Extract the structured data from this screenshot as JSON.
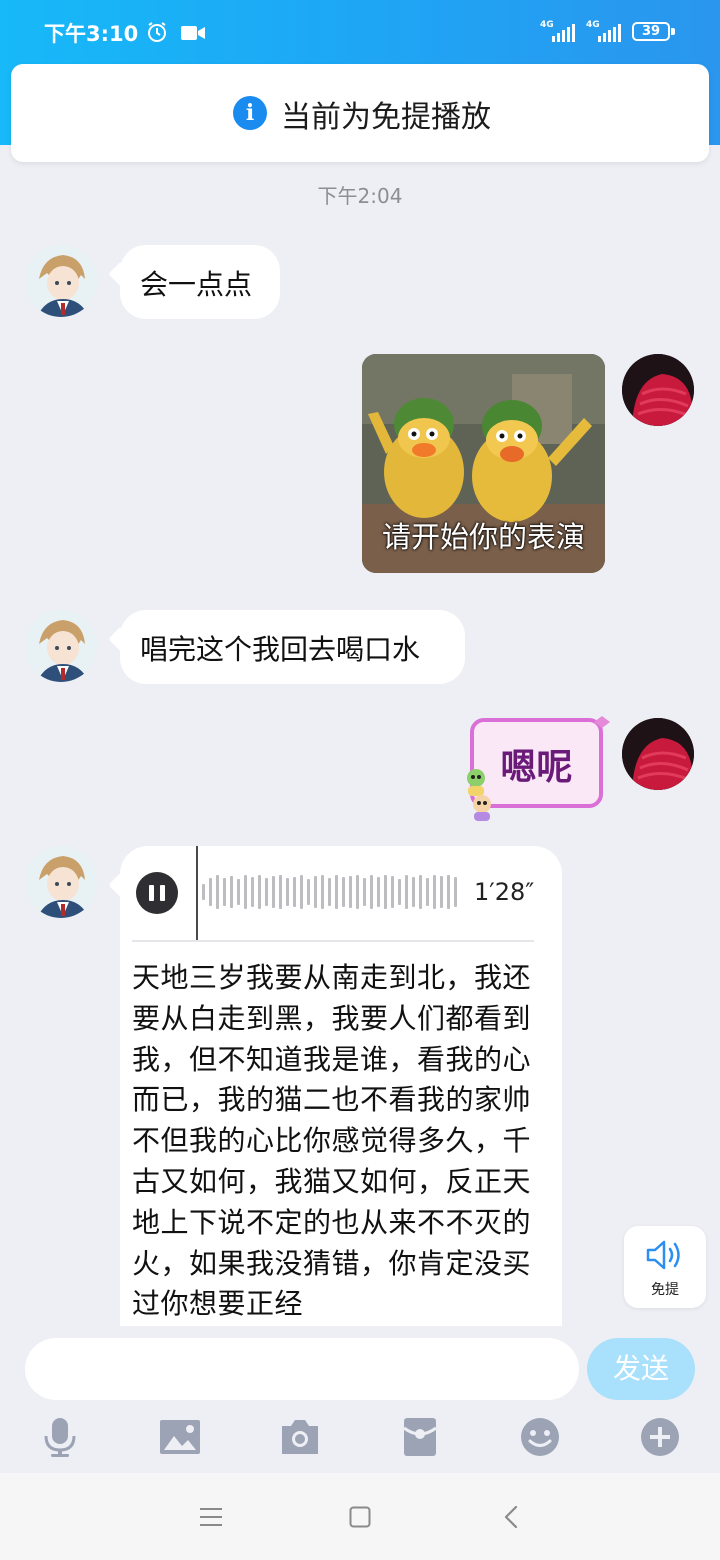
{
  "status_bar": {
    "time": "下午3:10",
    "network_1": "4G",
    "network_2": "4G",
    "battery": "39"
  },
  "notice": {
    "icon": "info-icon",
    "text": "当前为免提播放"
  },
  "chat": {
    "timestamp": "下午2:04",
    "messages": [
      {
        "from": "friend",
        "type": "text",
        "text": "会一点点"
      },
      {
        "from": "me",
        "type": "sticker",
        "caption": "请开始你的表演"
      },
      {
        "from": "friend",
        "type": "text",
        "text": "唱完这个我回去喝口水"
      },
      {
        "from": "me",
        "type": "sticker",
        "caption": "嗯呢"
      },
      {
        "from": "friend",
        "type": "voice",
        "duration": "1′28″",
        "transcript": "天地三岁我要从南走到北，我还要从白走到黑，我要人们都看到我，但不知道我是谁，看我的心而已，我的猫二也不看我的家帅不但我的心比你感觉得多久，千古又如何，我猫又如何，反正天地上下说不定的也从来不不灭的火，如果我没猜错，你肯定没买过你想要正经"
      }
    ]
  },
  "handsfree_button": {
    "icon": "speaker-icon",
    "label": "免提"
  },
  "composer": {
    "input_value": "",
    "send_label": "发送"
  },
  "toolbar": [
    "mic-icon",
    "image-icon",
    "camera-icon",
    "red-packet-icon",
    "emoji-icon",
    "plus-icon"
  ],
  "colors": {
    "accent": "#1ea6f5",
    "send_disabled": "#a9e0fb",
    "chat_background": "#eeeff5"
  }
}
